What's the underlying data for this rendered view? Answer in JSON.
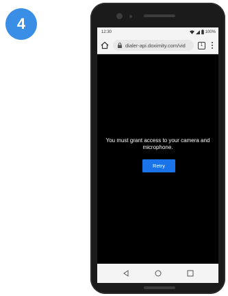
{
  "step": {
    "number": "4",
    "color": "#3a8ee6"
  },
  "status_bar": {
    "time": "12:30",
    "battery": "100%"
  },
  "browser": {
    "url": "dialer-api.doximity.com/vid",
    "tab_count": "1"
  },
  "page": {
    "message": "You must grant access to your camera and microphone.",
    "retry_label": "Retry",
    "button_color": "#1a73e8"
  },
  "nav_bar": {
    "icons": [
      "back-icon",
      "home-icon",
      "recents-icon"
    ]
  }
}
